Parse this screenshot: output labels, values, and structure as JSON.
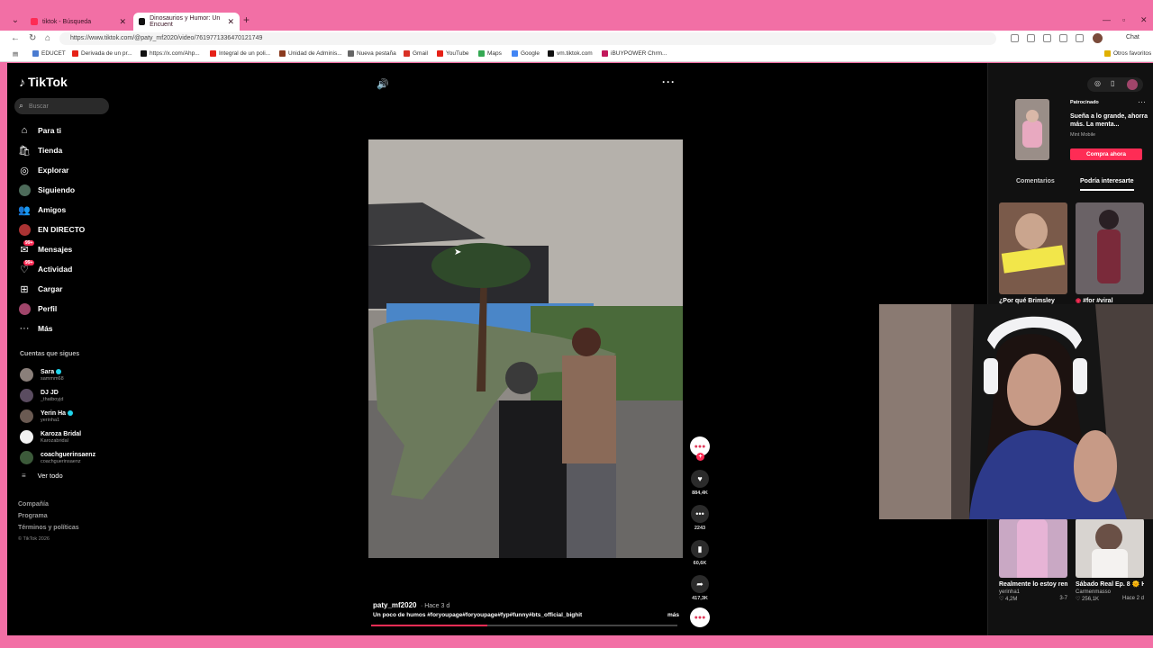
{
  "browser": {
    "tabs": [
      {
        "label": "tiktok - Búsqueda"
      },
      {
        "label": "Dinosaurios y Humor: Un Encuent"
      }
    ],
    "url": "https://www.tiktok.com/@paty_mf2020/video/7619771336470121749",
    "chat_label": "Chat",
    "bookmarks": [
      {
        "label": "EDUCET",
        "color": "#4a7bd0"
      },
      {
        "label": "Derivada de un pr...",
        "color": "#e62117"
      },
      {
        "label": "https://x.com/Ahp...",
        "color": "#111111"
      },
      {
        "label": "Integral de un poli...",
        "color": "#e62117"
      },
      {
        "label": "Unidad de Adminis...",
        "color": "#8a3a1e"
      },
      {
        "label": "Nueva pestaña",
        "color": "#666666"
      },
      {
        "label": "Gmail",
        "color": "#d93025"
      },
      {
        "label": "YouTube",
        "color": "#e62117"
      },
      {
        "label": "Maps",
        "color": "#34a853"
      },
      {
        "label": "Google",
        "color": "#4285f4"
      },
      {
        "label": "vm.tiktok.com",
        "color": "#111111"
      },
      {
        "label": "iBUYPOWER Chrm...",
        "color": "#c2185b"
      }
    ],
    "other_bookmarks": "Otros favoritos"
  },
  "sidebar": {
    "logo": "TikTok",
    "search_placeholder": "Buscar",
    "nav": [
      {
        "label": "Para ti",
        "icon": "home-icon"
      },
      {
        "label": "Tienda",
        "icon": "shop-icon"
      },
      {
        "label": "Explorar",
        "icon": "compass-icon"
      },
      {
        "label": "Siguiendo",
        "icon": "following-avatar"
      },
      {
        "label": "Amigos",
        "icon": "friends-icon"
      },
      {
        "label": "EN DIRECTO",
        "icon": "live-icon"
      },
      {
        "label": "Mensajes",
        "icon": "message-icon",
        "badge": "99+"
      },
      {
        "label": "Actividad",
        "icon": "activity-icon",
        "badge": "99+"
      },
      {
        "label": "Cargar",
        "icon": "upload-icon"
      },
      {
        "label": "Perfil",
        "icon": "profile-avatar"
      },
      {
        "label": "Más",
        "icon": "more-dots-icon"
      }
    ],
    "following_title": "Cuentas que sigues",
    "following": [
      {
        "name": "Sara",
        "handle": "sammm68",
        "verified": true,
        "color": "#8a7f7a"
      },
      {
        "name": "DJ JD",
        "handle": "_thatboyjd",
        "verified": false,
        "color": "#5a4c60"
      },
      {
        "name": "Yerin Ha",
        "handle": "yerinha1",
        "verified": true,
        "color": "#6a5a52"
      },
      {
        "name": "Karoza Bridal",
        "handle": "Karozabridal",
        "verified": false,
        "color": "#f2f2f2"
      },
      {
        "name": "coachguerinsaenz",
        "handle": "coachguerinsaenz",
        "verified": false,
        "color": "#3c5a3a"
      }
    ],
    "see_all": "Ver todo",
    "footer": [
      "Compañía",
      "Programa",
      "Términos y políticas"
    ],
    "copyright": "© TikTok 2026"
  },
  "video": {
    "username": "paty_mf2020",
    "posted": "Hace 3 d",
    "description": "Un poco de humos #foryoupage#foryoupage#fyp#funny#bts_official_bighit",
    "more_label": "más",
    "progress": 0.38,
    "actions": {
      "likes": "884,4K",
      "comments": "2243",
      "saves": "60,6K",
      "shares": "417,3K"
    },
    "creator_badge": "●●●"
  },
  "right_panel": {
    "ad": {
      "sponsored": "Patrocinado",
      "title": "Sueña a lo grande, ahorra más. La menta...",
      "brand": "Mint Mobile",
      "cta": "Compra ahora"
    },
    "tabs": [
      "Comentarios",
      "Podría interesarte"
    ],
    "grid": [
      {
        "title": "¿Por qué Brimsley",
        "thumb_color": "#7a5a4a"
      },
      {
        "title": "#for #viral",
        "thumb_color": "#5a4e52"
      },
      {
        "title": "Realmente lo estoy remetiend...",
        "author": "yerinha1",
        "plays": "4,2M",
        "date": "3-7",
        "thumb_color": "#c9a8c4"
      },
      {
        "title": "Sábado Real Ep. 8 🌞 Hoy ha sido...",
        "author": "Carmenmasso",
        "plays": "256,1K",
        "date": "Hace 2 d",
        "thumb_color": "#d8d4d0"
      }
    ]
  }
}
